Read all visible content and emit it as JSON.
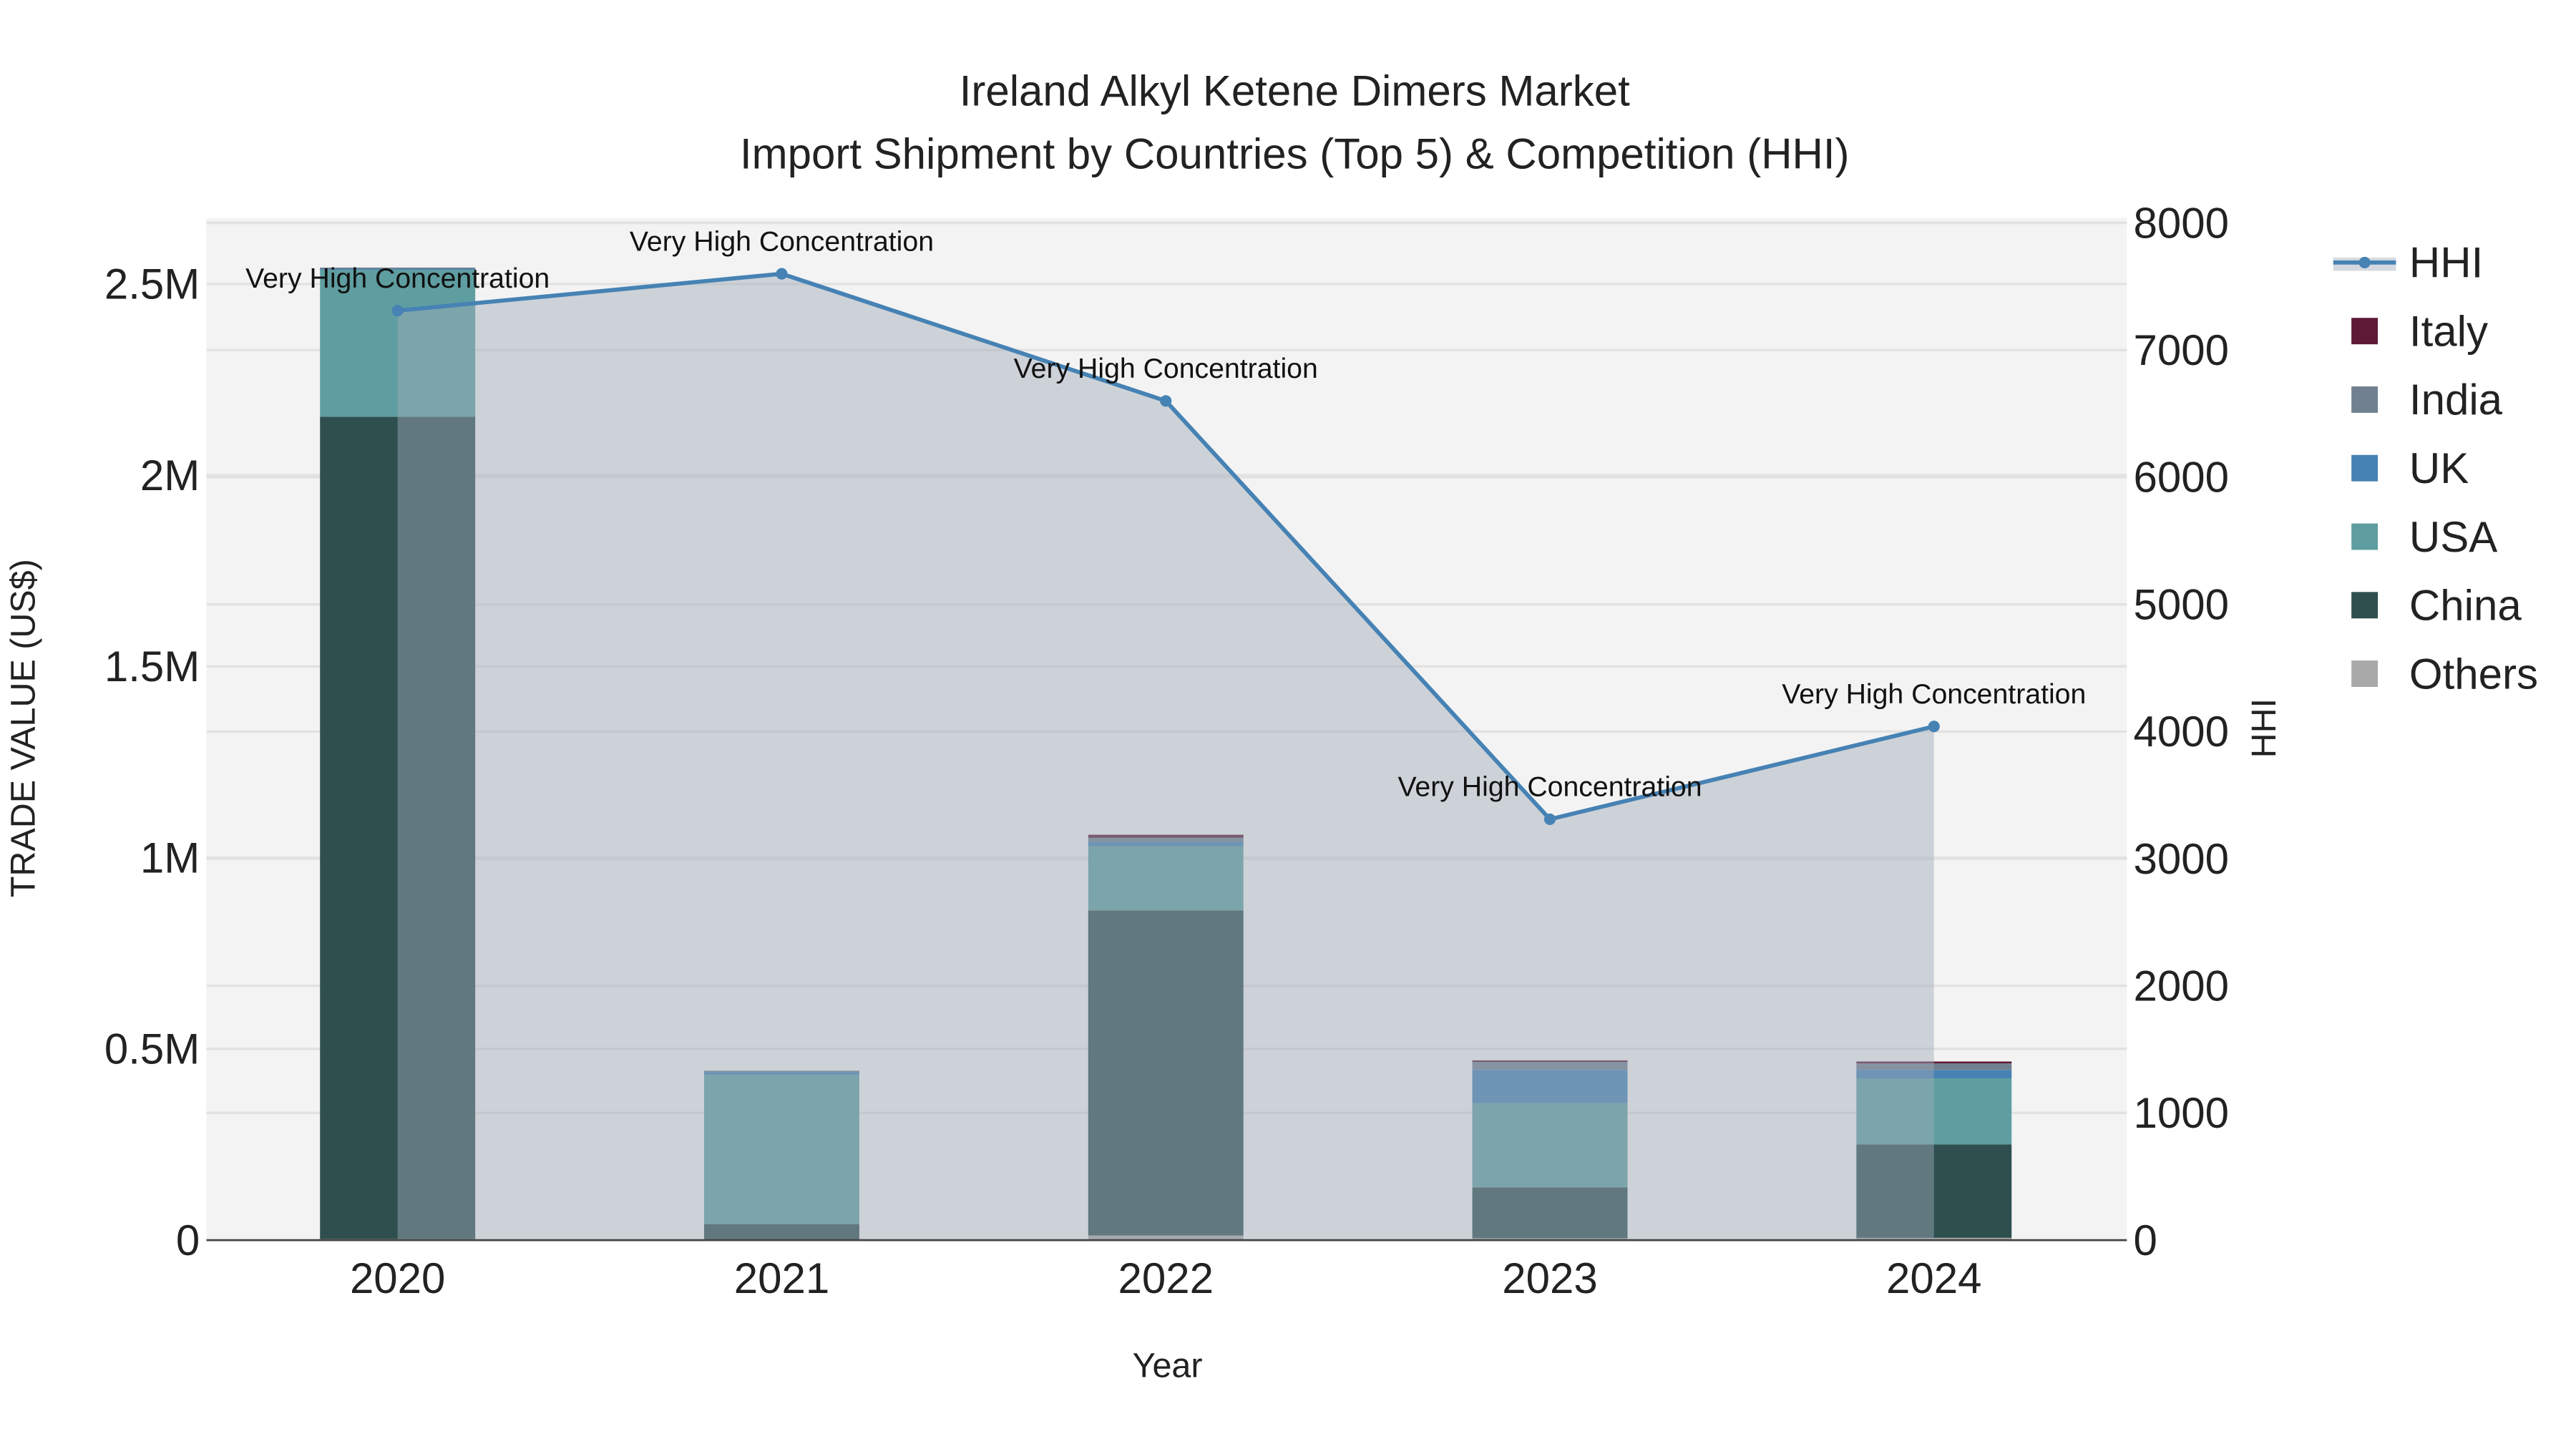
{
  "chart_data": {
    "type": "bar",
    "title": "Ireland Alkyl Ketene Dimers Market",
    "subtitle": "Import Shipment by Countries (Top 5) & Competition (HHI)",
    "xlabel": "Year",
    "ylabel": "TRADE VALUE (US$)",
    "y2label": "HHI",
    "categories": [
      "2020",
      "2021",
      "2022",
      "2023",
      "2024"
    ],
    "ylim": [
      0,
      2650000
    ],
    "y2lim": [
      0,
      8000
    ],
    "yticks": [
      {
        "v": 0,
        "label": "0"
      },
      {
        "v": 500000,
        "label": "0.5M"
      },
      {
        "v": 1000000,
        "label": "1M"
      },
      {
        "v": 1500000,
        "label": "1.5M"
      },
      {
        "v": 2000000,
        "label": "2M"
      },
      {
        "v": 2500000,
        "label": "2.5M"
      }
    ],
    "y2ticks": [
      {
        "v": 0,
        "label": "0"
      },
      {
        "v": 1000,
        "label": "1000"
      },
      {
        "v": 2000,
        "label": "2000"
      },
      {
        "v": 3000,
        "label": "3000"
      },
      {
        "v": 4000,
        "label": "4000"
      },
      {
        "v": 5000,
        "label": "5000"
      },
      {
        "v": 6000,
        "label": "6000"
      },
      {
        "v": 7000,
        "label": "7000"
      },
      {
        "v": 8000,
        "label": "8000"
      }
    ],
    "series": [
      {
        "name": "Others",
        "color": "#a9a9a9",
        "values": [
          3000,
          2000,
          12000,
          5000,
          6000
        ]
      },
      {
        "name": "China",
        "color": "#2f4f4f",
        "values": [
          2150000,
          40000,
          850000,
          133000,
          244000
        ]
      },
      {
        "name": "USA",
        "color": "#5f9ea0",
        "values": [
          385000,
          390000,
          168000,
          220000,
          173000
        ]
      },
      {
        "name": "UK",
        "color": "#4682b4",
        "values": [
          3000,
          10000,
          12000,
          87000,
          22000
        ]
      },
      {
        "name": "India",
        "color": "#708090",
        "values": [
          2000,
          1000,
          10000,
          21000,
          17000
        ]
      },
      {
        "name": "Italy",
        "color": "#5c1a36",
        "values": [
          0,
          0,
          8000,
          4000,
          5000
        ]
      }
    ],
    "hhi": {
      "name": "HHI",
      "color": "#4682b4",
      "values": [
        7310,
        7600,
        6600,
        3310,
        4040
      ],
      "annotations": [
        "Very High Concentration",
        "Very High Concentration",
        "Very High Concentration",
        "Very High Concentration",
        "Very High Concentration"
      ]
    },
    "legend": [
      "HHI",
      "Italy",
      "India",
      "UK",
      "USA",
      "China",
      "Others"
    ],
    "legend_position": "right",
    "grid": true
  }
}
